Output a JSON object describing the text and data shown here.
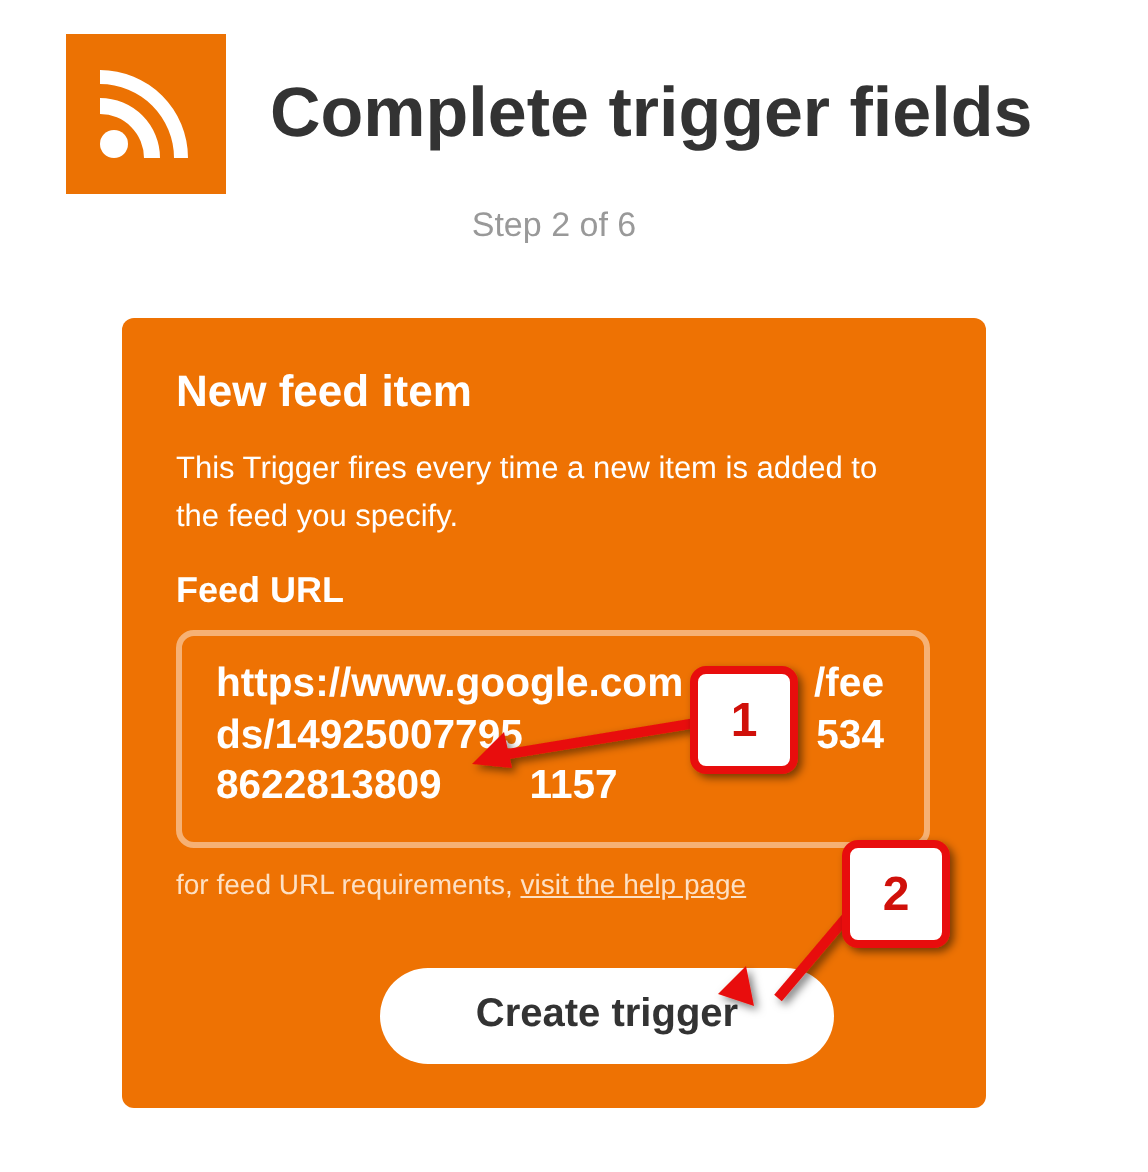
{
  "header": {
    "title": "Complete trigger fields",
    "step": "Step 2 of 6"
  },
  "card": {
    "title": "New feed item",
    "description": "This Trigger fires every time a new item is added to the feed you specify.",
    "field_label": "Feed URL",
    "field_value_lines": [
      [
        "https://www.google.com",
        "/fee"
      ],
      [
        "ds/14925007795",
        "534"
      ],
      [
        "8622813809",
        "1157"
      ]
    ],
    "help_text": "for feed URL requirements,",
    "help_link": "visit the help page",
    "button": "Create trigger"
  },
  "callouts": [
    {
      "label": "1"
    },
    {
      "label": "2"
    }
  ]
}
